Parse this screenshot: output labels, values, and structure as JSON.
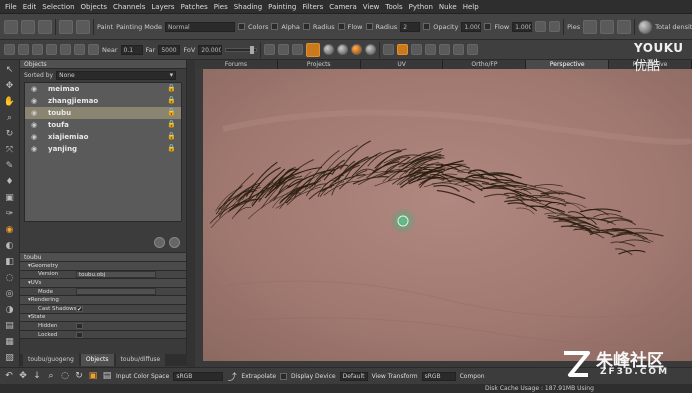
{
  "menubar": {
    "items": [
      "File",
      "Edit",
      "Selection",
      "Objects",
      "Channels",
      "Layers",
      "Patches",
      "Pies",
      "Shading",
      "Painting",
      "Filters",
      "Camera",
      "View",
      "Tools",
      "Python",
      "Nuke",
      "Help"
    ]
  },
  "toolbar1": {
    "paint_label": "Paint",
    "painting_mode_label": "Painting Mode",
    "painting_mode_value": "Normal",
    "colors_label": "Colors",
    "alpha_label": "Alpha",
    "radius_label": "Radius",
    "flow_label": "Flow",
    "radius2_label": "Radius",
    "radius_value": "2",
    "opacity_label": "Opacity",
    "opacity_value": "1.000",
    "flow2_label": "Flow",
    "flow_value": "1.000",
    "pies_label": "Pies",
    "total_density_label": "Total density"
  },
  "toolbar2": {
    "near_label": "Near",
    "near_value": "0.1",
    "far_label": "Far",
    "far_value": "5000",
    "fov_label": "FoV",
    "fov_value": "20.000"
  },
  "outliner": {
    "title": "Objects",
    "sorted_by_label": "Sorted by",
    "sorted_by_value": "None",
    "items": [
      {
        "name": "meimao",
        "selected": false
      },
      {
        "name": "zhangjiemao",
        "selected": false
      },
      {
        "name": "toubu",
        "selected": true
      },
      {
        "name": "toufa",
        "selected": false
      },
      {
        "name": "xiajiemiao",
        "selected": false
      },
      {
        "name": "yanjing",
        "selected": false
      }
    ]
  },
  "properties": {
    "object_name": "toubu",
    "rows": [
      {
        "type": "section",
        "label": "Geometry"
      },
      {
        "type": "field",
        "label": "Version",
        "value": "toubu.obj"
      },
      {
        "type": "section",
        "label": "UVs"
      },
      {
        "type": "field",
        "label": "Mode",
        "value": ""
      },
      {
        "type": "section",
        "label": "Rendering"
      },
      {
        "type": "check",
        "label": "Cast Shadows",
        "value": "✔"
      },
      {
        "type": "section",
        "label": "State"
      },
      {
        "type": "check",
        "label": "Hidden",
        "value": ""
      },
      {
        "type": "check",
        "label": "Locked",
        "value": ""
      }
    ]
  },
  "panel_tabs": [
    "toubu/guogeng",
    "Objects",
    "toubu/diffuse"
  ],
  "viewport_tabs": [
    {
      "label": "Forums",
      "active": false
    },
    {
      "label": "Projects",
      "active": false
    },
    {
      "label": "UV",
      "active": false
    },
    {
      "label": "Ortho/FP",
      "active": false
    },
    {
      "label": "Perspective",
      "active": true
    },
    {
      "label": "Perspective",
      "active": false
    }
  ],
  "statusbar": {
    "input_color_space_label": "Input Color Space",
    "input_color_space_value": "sRGB",
    "extrapolate_label": "Extrapolate",
    "display_device_label": "Display Device",
    "display_device_value": "Default",
    "view_transform_label": "View Transform",
    "view_transform_value": "sRGB",
    "component_label": "Compon",
    "disk_cache": "Disk Cache Usage : 187.91MB  Using"
  },
  "watermarks": {
    "youku_en": "YOUKU",
    "youku_cn": "优酷",
    "site_cn": "朱峰社区",
    "site_en": "ZF3D.COM"
  },
  "colors": {
    "skin": "#a27a73",
    "brow": "#2a1d10",
    "accent": "#f0a030",
    "cursor": "#2fa870"
  }
}
